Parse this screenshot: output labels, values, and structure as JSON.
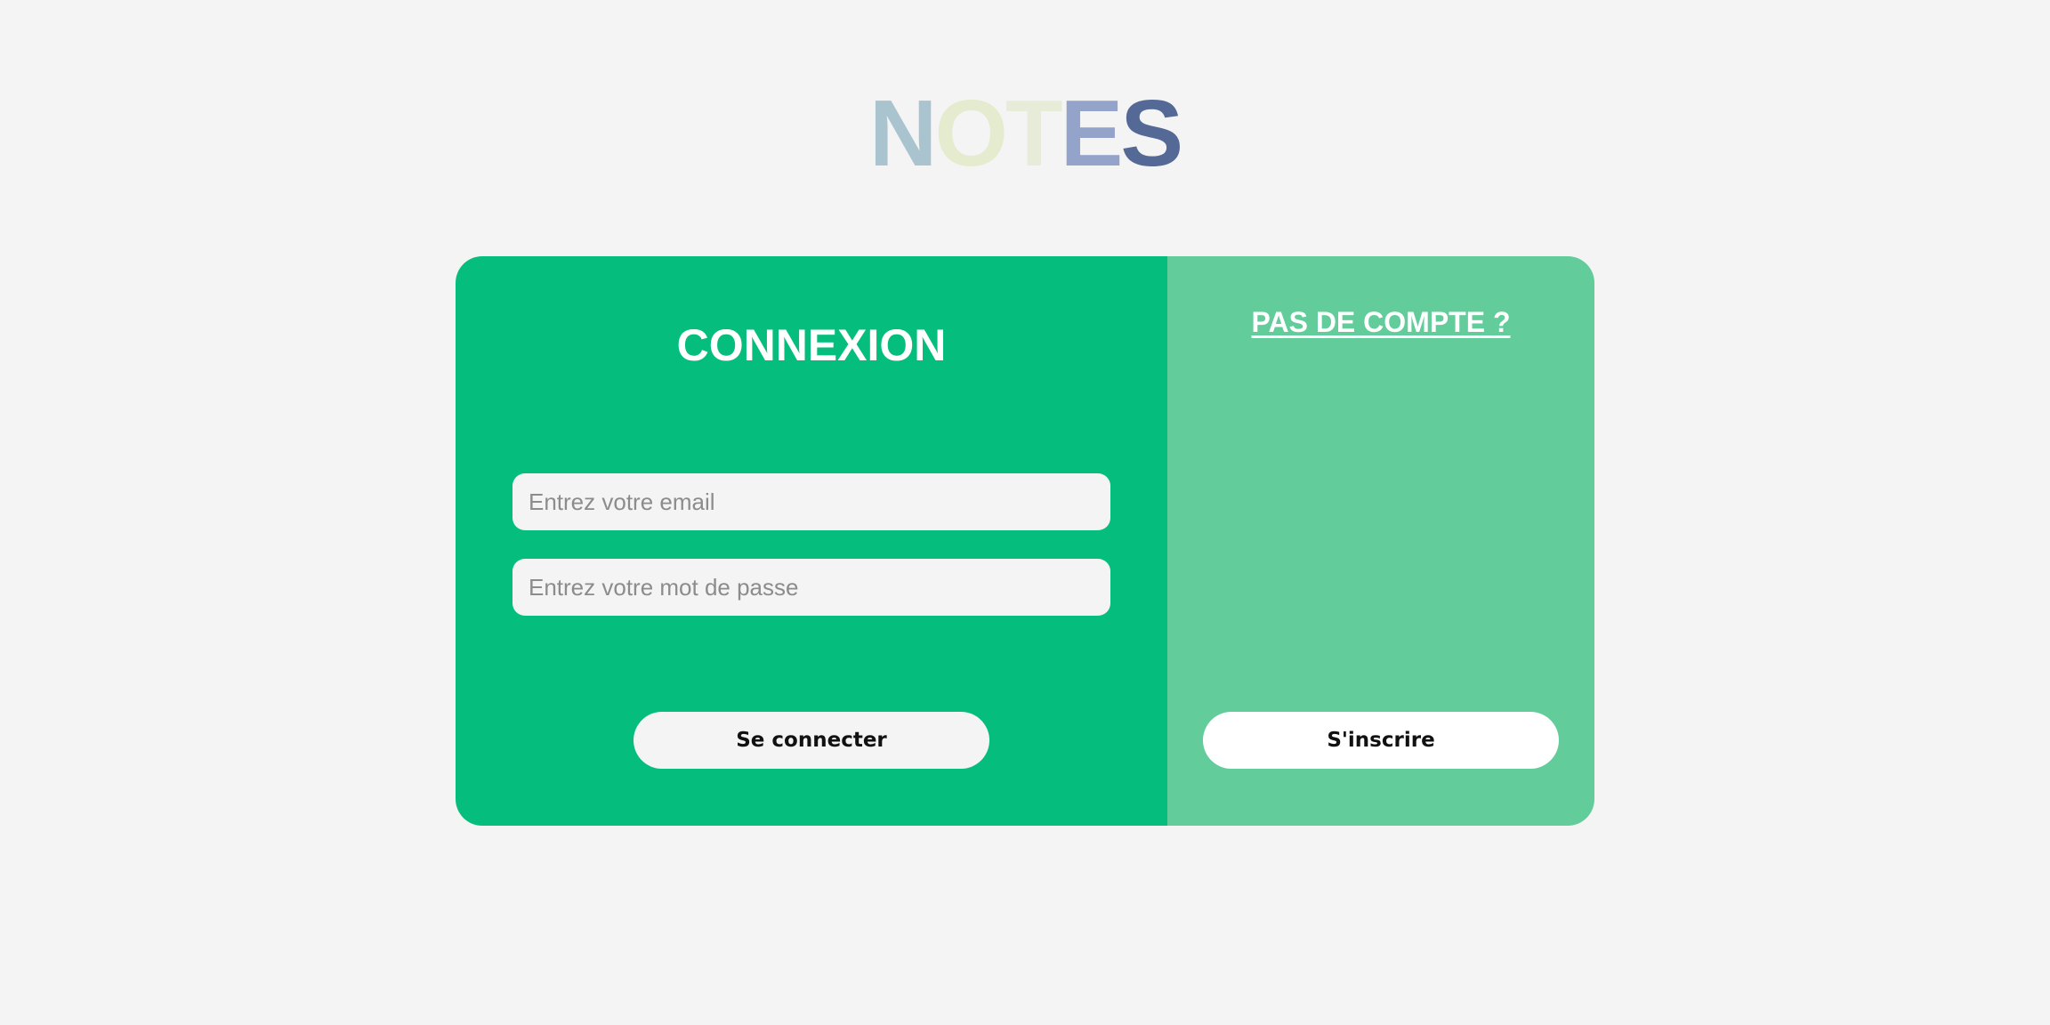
{
  "logo": {
    "letters": [
      "N",
      "O",
      "T",
      "E",
      "S"
    ],
    "colors": [
      "#a9c3cf",
      "#e5ebce",
      "#e7ecd9",
      "#93a3c9",
      "#546995"
    ]
  },
  "login": {
    "title": "CONNEXION",
    "email_placeholder": "Entrez votre email",
    "password_placeholder": "Entrez votre mot de passe",
    "submit_label": "Se connecter"
  },
  "signup": {
    "prompt": "PAS DE COMPTE ?",
    "button_label": "S'inscrire"
  },
  "colors": {
    "page_background": "#f4f4f4",
    "login_panel": "#05be7e",
    "signup_panel": "#62cc9b",
    "input_background": "#f4f4f4",
    "login_button": "#f4f4f4",
    "signup_button": "#ffffff",
    "heading_text": "#ffffff"
  }
}
